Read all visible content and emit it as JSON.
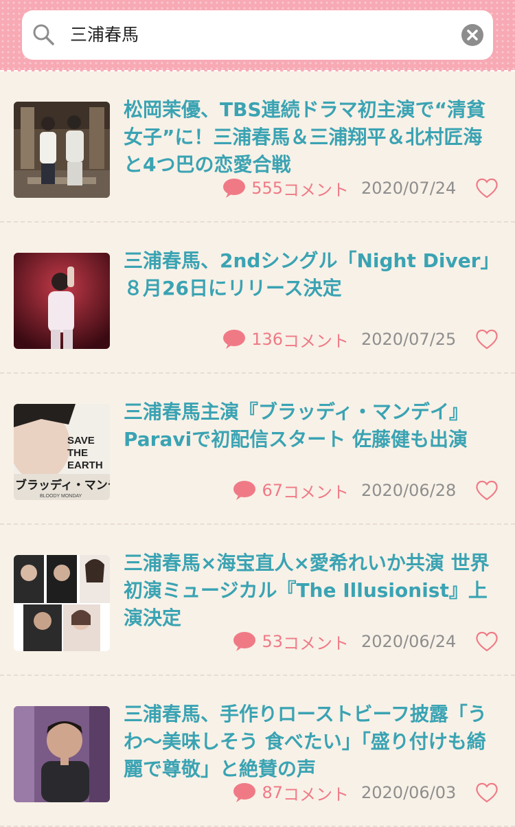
{
  "search": {
    "query": "三浦春馬"
  },
  "comment_suffix": "コメント",
  "articles": [
    {
      "title": "松岡茉優、TBS連続ドラマ初主演で“清貧女子”に！三浦春馬＆三浦翔平＆北村匠海と4つ巴の恋愛合戦",
      "comments": "555",
      "date": "2020/07/24"
    },
    {
      "title": "三浦春馬、2ndシングル「Night Diver」８月26日にリリース決定",
      "comments": "136",
      "date": "2020/07/25"
    },
    {
      "title": "三浦春馬主演『ブラッディ・マンデイ』Paraviで初配信スタート 佐藤健も出演",
      "comments": "67",
      "date": "2020/06/28",
      "thumb_text": {
        "line1": "SAVE",
        "line2": "THE",
        "line3": "EARTH",
        "logo": "ブラッディ・マンデ",
        "logo_sub": "BLOODY MONDAY"
      }
    },
    {
      "title": "三浦春馬×海宝直人×愛希れいか共演 世界初演ミュージカル『The Illusionist』上演決定",
      "comments": "53",
      "date": "2020/06/24"
    },
    {
      "title": "三浦春馬、手作りローストビーフ披露「うわ〜美味しそう 食べたい」「盛り付けも綺麗で尊敬」と絶賛の声",
      "comments": "87",
      "date": "2020/06/03"
    }
  ],
  "colors": {
    "header_pink": "#f7a9b4",
    "title_teal": "#3aa3b3",
    "comment_pink": "#ef7a86",
    "date_gray": "#8e8e8e",
    "background": "#f8f1e7"
  },
  "icons": [
    "search-icon",
    "clear-icon",
    "comment-icon",
    "heart-icon"
  ]
}
